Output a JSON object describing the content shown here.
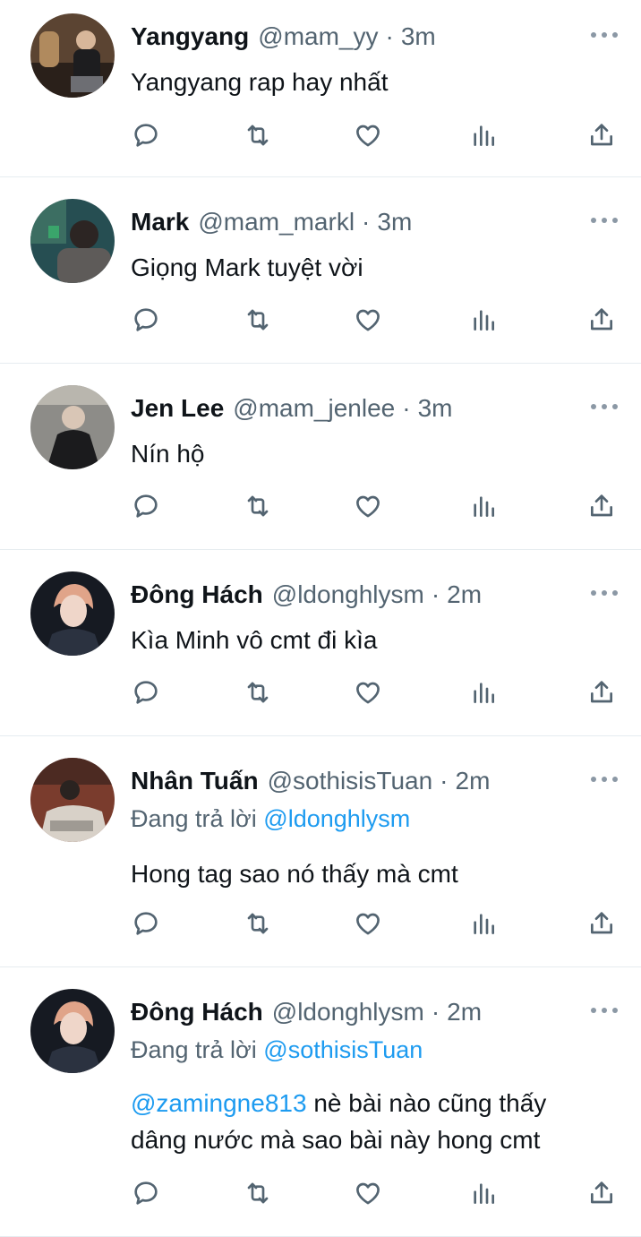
{
  "tweets": [
    {
      "name": "Yangyang",
      "handle": "@mam_yy",
      "sep": "·",
      "time": "3m",
      "text": "Yangyang rap hay nhất"
    },
    {
      "name": "Mark",
      "handle": "@mam_markl",
      "sep": "·",
      "time": "3m",
      "text": "Giọng Mark tuyệt vời"
    },
    {
      "name": "Jen Lee",
      "handle": "@mam_jenlee",
      "sep": "·",
      "time": "3m",
      "text": "Nín hộ"
    },
    {
      "name": "Đông Hách",
      "handle": "@ldonghlysm",
      "sep": "·",
      "time": "2m",
      "text": "Kìa Minh vô cmt đi kìa"
    },
    {
      "name": "Nhân Tuấn",
      "handle": "@sothisisTuan",
      "sep": "·",
      "time": "2m",
      "reply_prefix": "Đang trả lời",
      "reply_mention": "@ldonghlysm",
      "text": "Hong tag sao nó thấy mà cmt"
    },
    {
      "name": "Đông Hách",
      "handle": "@ldonghlysm",
      "sep": "·",
      "time": "2m",
      "reply_prefix": "Đang trả lời",
      "reply_mention": "@sothisisTuan",
      "text_mention": "@zamingne813",
      "text_line1": " nè bài nào cũng thấy",
      "text_line2": "dâng nước mà sao bài này hong cmt"
    }
  ],
  "icons": [
    "reply-icon",
    "retweet-icon",
    "like-icon",
    "analytics-icon",
    "share-icon",
    "more-icon"
  ],
  "colors": {
    "mention": "#1d9bf0",
    "secondary_text": "#536471",
    "divider": "#e6ecf0"
  }
}
